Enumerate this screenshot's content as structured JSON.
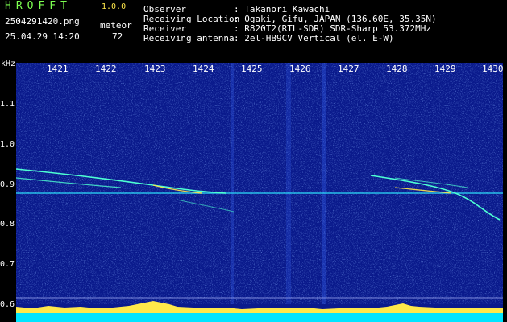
{
  "header": {
    "logo": "HROFFT",
    "version": "1.0.0",
    "filename": "2504291420.png",
    "datetime": "25.04.29 14:20",
    "mode_label": "meteor",
    "count": "72"
  },
  "info": [
    {
      "label": "Observer",
      "value": ": Takanori Kawachi"
    },
    {
      "label": "Receiving Location",
      "value": ": Ogaki, Gifu, JAPAN (136.60E, 35.35N)"
    },
    {
      "label": "Receiver",
      "value": ": R820T2(RTL-SDR) SDR-Sharp 53.372MHz"
    },
    {
      "label": "Receiving antenna",
      "value": ": 2el-HB9CV Vertical (el. E-W)"
    }
  ],
  "axes": {
    "y_unit": "kHz",
    "x_ticks": [
      "1421",
      "1422",
      "1423",
      "1424",
      "1425",
      "1426",
      "1427",
      "1428",
      "1429",
      "1430"
    ],
    "y_ticks": [
      "1.1",
      "1.0",
      "0.9",
      "0.8",
      "0.7",
      "0.6"
    ]
  },
  "colors": {
    "background": "#0a1a8c",
    "header_green": "#7CFF50",
    "signal_yellow": "#ffe84a",
    "strip_cyan": "#00e5ff"
  }
}
